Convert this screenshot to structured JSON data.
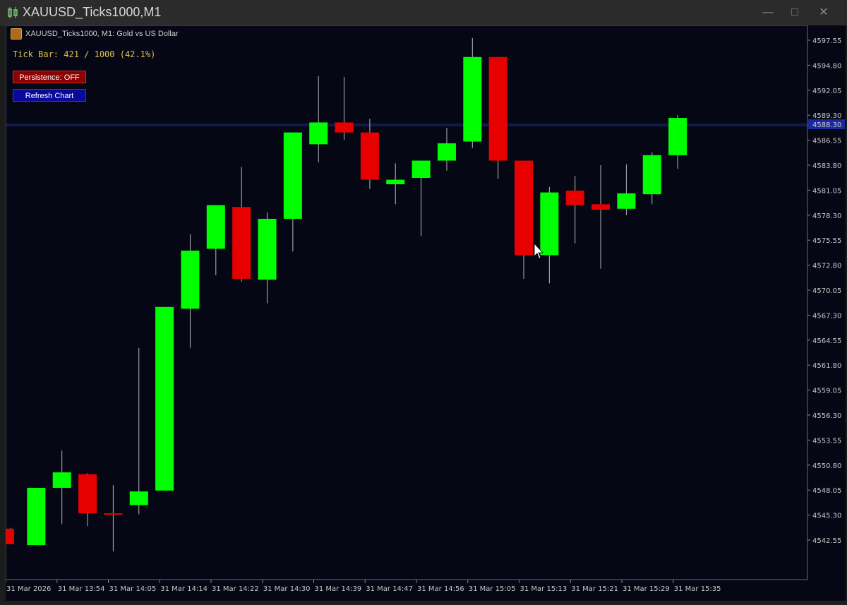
{
  "window": {
    "title": "XAUUSD_Ticks1000,M1",
    "controls": [
      "minimize-icon",
      "maximize-icon",
      "close-icon"
    ]
  },
  "chart_info": {
    "header": "XAUUSD_Ticks1000, M1:  Gold vs US Dollar",
    "tick_status": "Tick Bar: 421 / 1000 (42.1%)"
  },
  "buttons": {
    "persistence": "Persistence: OFF",
    "refresh": "Refresh Chart"
  },
  "colors": {
    "background": "#050814",
    "bull": "#00ff00",
    "bear": "#e60000",
    "axis_text": "#c8c8c8",
    "price_line": "#1f2a8a"
  },
  "chart_data": {
    "type": "candlestick",
    "symbol": "XAUUSD",
    "timeframe": "M1",
    "ylim": [
      4540.3,
      4598.4
    ],
    "y_ticks": [
      "4597.55",
      "4594.80",
      "4592.05",
      "4589.30",
      "4586.55",
      "4583.80",
      "4581.05",
      "4578.30",
      "4575.55",
      "4572.80",
      "4570.05",
      "4567.30",
      "4564.55",
      "4561.80",
      "4559.05",
      "4556.30",
      "4553.55",
      "4550.80",
      "4548.05",
      "4545.30",
      "4542.55"
    ],
    "x_ticks": [
      "31 Mar 2026",
      "31 Mar 13:54",
      "31 Mar 14:05",
      "31 Mar 14:14",
      "31 Mar 14:22",
      "31 Mar 14:30",
      "31 Mar 14:39",
      "31 Mar 14:47",
      "31 Mar 14:56",
      "31 Mar 15:05",
      "31 Mar 15:13",
      "31 Mar 15:21",
      "31 Mar 15:29",
      "31 Mar 15:35"
    ],
    "current_price": 4588.3,
    "current_price_label": "4588.30",
    "candles": [
      {
        "o": 4543.8,
        "h": 4543.9,
        "l": 4542.1,
        "c": 4542.1
      },
      {
        "o": 4542.0,
        "h": 4548.3,
        "l": 4542.0,
        "c": 4548.3
      },
      {
        "o": 4548.3,
        "h": 4552.4,
        "l": 4544.3,
        "c": 4550.0
      },
      {
        "o": 4549.8,
        "h": 4549.9,
        "l": 4544.1,
        "c": 4545.5
      },
      {
        "o": 4545.5,
        "h": 4548.6,
        "l": 4541.3,
        "c": 4545.4
      },
      {
        "o": 4546.4,
        "h": 4563.7,
        "l": 4545.4,
        "c": 4547.9
      },
      {
        "o": 4548.0,
        "h": 4568.2,
        "l": 4548.0,
        "c": 4568.2
      },
      {
        "o": 4568.0,
        "h": 4576.2,
        "l": 4563.7,
        "c": 4574.4
      },
      {
        "o": 4574.6,
        "h": 4579.4,
        "l": 4571.7,
        "c": 4579.4
      },
      {
        "o": 4579.2,
        "h": 4583.6,
        "l": 4571.0,
        "c": 4571.3
      },
      {
        "o": 4571.2,
        "h": 4578.6,
        "l": 4568.6,
        "c": 4577.9
      },
      {
        "o": 4577.9,
        "h": 4587.4,
        "l": 4574.3,
        "c": 4587.4
      },
      {
        "o": 4586.1,
        "h": 4593.6,
        "l": 4584.1,
        "c": 4588.5
      },
      {
        "o": 4588.5,
        "h": 4593.5,
        "l": 4586.6,
        "c": 4587.4
      },
      {
        "o": 4587.4,
        "h": 4588.9,
        "l": 4581.2,
        "c": 4582.2
      },
      {
        "o": 4581.7,
        "h": 4584.0,
        "l": 4579.5,
        "c": 4582.2
      },
      {
        "o": 4582.4,
        "h": 4584.3,
        "l": 4576.0,
        "c": 4584.3
      },
      {
        "o": 4584.3,
        "h": 4587.9,
        "l": 4583.2,
        "c": 4586.2
      },
      {
        "o": 4586.4,
        "h": 4597.8,
        "l": 4585.7,
        "c": 4595.7
      },
      {
        "o": 4595.7,
        "h": 4595.7,
        "l": 4582.3,
        "c": 4584.3
      },
      {
        "o": 4584.3,
        "h": 4584.3,
        "l": 4571.3,
        "c": 4573.9
      },
      {
        "o": 4573.9,
        "h": 4581.4,
        "l": 4570.8,
        "c": 4580.8
      },
      {
        "o": 4581.0,
        "h": 4582.6,
        "l": 4575.2,
        "c": 4579.4
      },
      {
        "o": 4579.5,
        "h": 4583.8,
        "l": 4572.4,
        "c": 4578.9
      },
      {
        "o": 4579.0,
        "h": 4583.9,
        "l": 4578.3,
        "c": 4580.7
      },
      {
        "o": 4580.6,
        "h": 4585.2,
        "l": 4579.5,
        "c": 4584.9
      },
      {
        "o": 4584.9,
        "h": 4589.3,
        "l": 4583.4,
        "c": 4589.0
      }
    ]
  }
}
